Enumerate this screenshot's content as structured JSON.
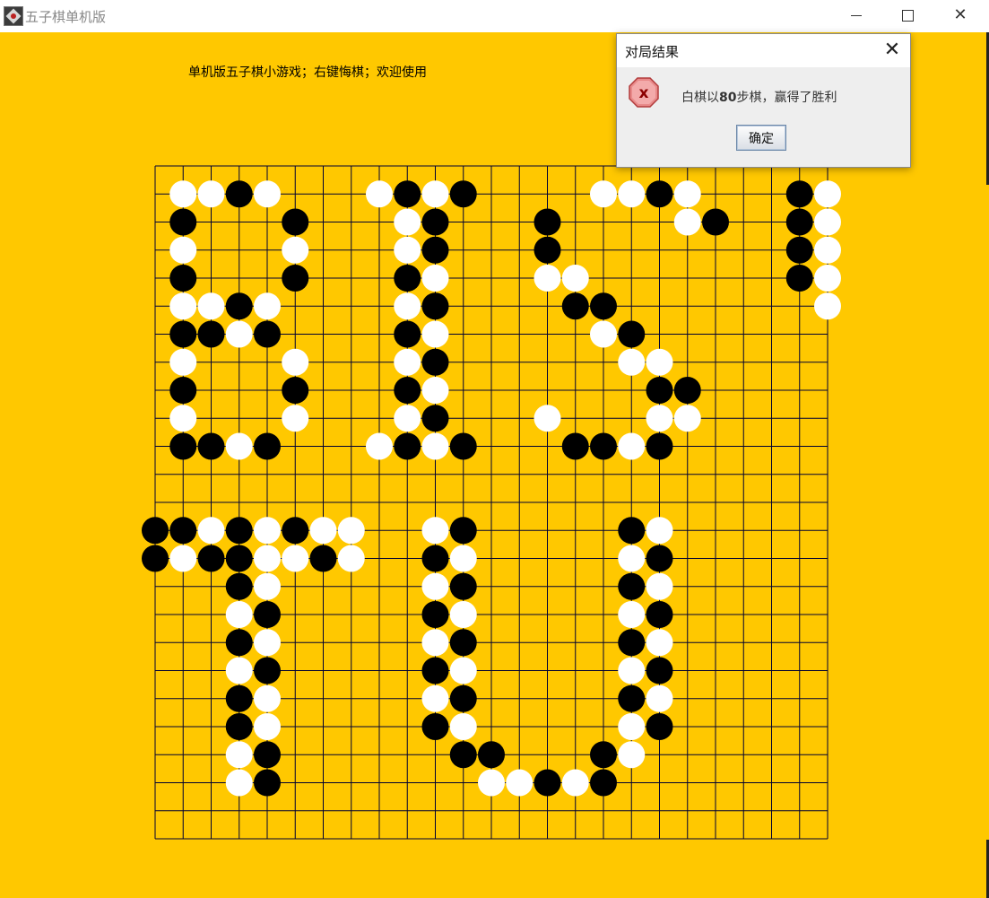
{
  "window": {
    "title": "五子棋单机版"
  },
  "game": {
    "welcome_text": "单机版五子棋小游戏；右键悔棋；欢迎使用",
    "board": {
      "size": 25,
      "background_color": "#ffc800",
      "line_color": "#000033",
      "white_stone_color": "#ffffff",
      "black_stone_color": "#000000",
      "stones": [
        [
          1,
          1,
          "W"
        ],
        [
          2,
          1,
          "W"
        ],
        [
          3,
          1,
          "B"
        ],
        [
          4,
          1,
          "W"
        ],
        [
          8,
          1,
          "W"
        ],
        [
          9,
          1,
          "B"
        ],
        [
          10,
          1,
          "W"
        ],
        [
          11,
          1,
          "B"
        ],
        [
          16,
          1,
          "W"
        ],
        [
          17,
          1,
          "W"
        ],
        [
          18,
          1,
          "B"
        ],
        [
          19,
          1,
          "W"
        ],
        [
          23,
          1,
          "B"
        ],
        [
          24,
          1,
          "W"
        ],
        [
          1,
          2,
          "B"
        ],
        [
          5,
          2,
          "B"
        ],
        [
          9,
          2,
          "W"
        ],
        [
          10,
          2,
          "B"
        ],
        [
          14,
          2,
          "B"
        ],
        [
          19,
          2,
          "W"
        ],
        [
          20,
          2,
          "B"
        ],
        [
          23,
          2,
          "B"
        ],
        [
          24,
          2,
          "W"
        ],
        [
          1,
          3,
          "W"
        ],
        [
          5,
          3,
          "W"
        ],
        [
          9,
          3,
          "W"
        ],
        [
          10,
          3,
          "B"
        ],
        [
          14,
          3,
          "B"
        ],
        [
          23,
          3,
          "B"
        ],
        [
          24,
          3,
          "W"
        ],
        [
          1,
          4,
          "B"
        ],
        [
          5,
          4,
          "B"
        ],
        [
          9,
          4,
          "B"
        ],
        [
          10,
          4,
          "W"
        ],
        [
          14,
          4,
          "W"
        ],
        [
          15,
          4,
          "W"
        ],
        [
          23,
          4,
          "B"
        ],
        [
          24,
          4,
          "W"
        ],
        [
          1,
          5,
          "W"
        ],
        [
          2,
          5,
          "W"
        ],
        [
          3,
          5,
          "B"
        ],
        [
          4,
          5,
          "W"
        ],
        [
          9,
          5,
          "W"
        ],
        [
          10,
          5,
          "B"
        ],
        [
          15,
          5,
          "B"
        ],
        [
          16,
          5,
          "B"
        ],
        [
          24,
          5,
          "W"
        ],
        [
          1,
          6,
          "B"
        ],
        [
          2,
          6,
          "B"
        ],
        [
          3,
          6,
          "W"
        ],
        [
          4,
          6,
          "B"
        ],
        [
          9,
          6,
          "B"
        ],
        [
          10,
          6,
          "W"
        ],
        [
          16,
          6,
          "W"
        ],
        [
          17,
          6,
          "B"
        ],
        [
          1,
          7,
          "W"
        ],
        [
          5,
          7,
          "W"
        ],
        [
          9,
          7,
          "W"
        ],
        [
          10,
          7,
          "B"
        ],
        [
          17,
          7,
          "W"
        ],
        [
          18,
          7,
          "W"
        ],
        [
          1,
          8,
          "B"
        ],
        [
          5,
          8,
          "B"
        ],
        [
          9,
          8,
          "B"
        ],
        [
          10,
          8,
          "W"
        ],
        [
          18,
          8,
          "B"
        ],
        [
          19,
          8,
          "B"
        ],
        [
          1,
          9,
          "W"
        ],
        [
          5,
          9,
          "W"
        ],
        [
          9,
          9,
          "W"
        ],
        [
          10,
          9,
          "B"
        ],
        [
          14,
          9,
          "W"
        ],
        [
          18,
          9,
          "W"
        ],
        [
          19,
          9,
          "W"
        ],
        [
          1,
          10,
          "B"
        ],
        [
          2,
          10,
          "B"
        ],
        [
          3,
          10,
          "W"
        ],
        [
          4,
          10,
          "B"
        ],
        [
          8,
          10,
          "W"
        ],
        [
          9,
          10,
          "B"
        ],
        [
          10,
          10,
          "W"
        ],
        [
          11,
          10,
          "B"
        ],
        [
          15,
          10,
          "B"
        ],
        [
          16,
          10,
          "B"
        ],
        [
          17,
          10,
          "W"
        ],
        [
          18,
          10,
          "B"
        ],
        [
          0,
          13,
          "B"
        ],
        [
          1,
          13,
          "B"
        ],
        [
          2,
          13,
          "W"
        ],
        [
          3,
          13,
          "B"
        ],
        [
          4,
          13,
          "W"
        ],
        [
          5,
          13,
          "B"
        ],
        [
          6,
          13,
          "W"
        ],
        [
          7,
          13,
          "W"
        ],
        [
          10,
          13,
          "W"
        ],
        [
          11,
          13,
          "B"
        ],
        [
          17,
          13,
          "B"
        ],
        [
          18,
          13,
          "W"
        ],
        [
          0,
          14,
          "B"
        ],
        [
          1,
          14,
          "W"
        ],
        [
          2,
          14,
          "B"
        ],
        [
          3,
          14,
          "B"
        ],
        [
          4,
          14,
          "W"
        ],
        [
          5,
          14,
          "W"
        ],
        [
          6,
          14,
          "B"
        ],
        [
          7,
          14,
          "W"
        ],
        [
          10,
          14,
          "B"
        ],
        [
          11,
          14,
          "W"
        ],
        [
          17,
          14,
          "W"
        ],
        [
          18,
          14,
          "B"
        ],
        [
          3,
          15,
          "B"
        ],
        [
          4,
          15,
          "W"
        ],
        [
          10,
          15,
          "W"
        ],
        [
          11,
          15,
          "B"
        ],
        [
          17,
          15,
          "B"
        ],
        [
          18,
          15,
          "W"
        ],
        [
          3,
          16,
          "W"
        ],
        [
          4,
          16,
          "B"
        ],
        [
          10,
          16,
          "B"
        ],
        [
          11,
          16,
          "W"
        ],
        [
          17,
          16,
          "W"
        ],
        [
          18,
          16,
          "B"
        ],
        [
          3,
          17,
          "B"
        ],
        [
          4,
          17,
          "W"
        ],
        [
          10,
          17,
          "W"
        ],
        [
          11,
          17,
          "B"
        ],
        [
          17,
          17,
          "B"
        ],
        [
          18,
          17,
          "W"
        ],
        [
          3,
          18,
          "W"
        ],
        [
          4,
          18,
          "B"
        ],
        [
          10,
          18,
          "B"
        ],
        [
          11,
          18,
          "W"
        ],
        [
          17,
          18,
          "W"
        ],
        [
          18,
          18,
          "B"
        ],
        [
          3,
          19,
          "B"
        ],
        [
          4,
          19,
          "W"
        ],
        [
          10,
          19,
          "W"
        ],
        [
          11,
          19,
          "B"
        ],
        [
          17,
          19,
          "B"
        ],
        [
          18,
          19,
          "W"
        ],
        [
          3,
          20,
          "B"
        ],
        [
          4,
          20,
          "W"
        ],
        [
          10,
          20,
          "B"
        ],
        [
          11,
          20,
          "W"
        ],
        [
          17,
          20,
          "W"
        ],
        [
          18,
          20,
          "B"
        ],
        [
          3,
          21,
          "W"
        ],
        [
          4,
          21,
          "B"
        ],
        [
          11,
          21,
          "B"
        ],
        [
          12,
          21,
          "B"
        ],
        [
          16,
          21,
          "B"
        ],
        [
          17,
          21,
          "W"
        ],
        [
          3,
          22,
          "W"
        ],
        [
          4,
          22,
          "B"
        ],
        [
          12,
          22,
          "W"
        ],
        [
          13,
          22,
          "W"
        ],
        [
          14,
          22,
          "B"
        ],
        [
          15,
          22,
          "W"
        ],
        [
          16,
          22,
          "B"
        ]
      ]
    }
  },
  "dialog": {
    "title": "对局结果",
    "message_prefix": "白棋以",
    "message_steps": "80",
    "message_suffix": "步棋，赢得了胜利",
    "ok_label": "确定",
    "icon": "error-icon"
  }
}
